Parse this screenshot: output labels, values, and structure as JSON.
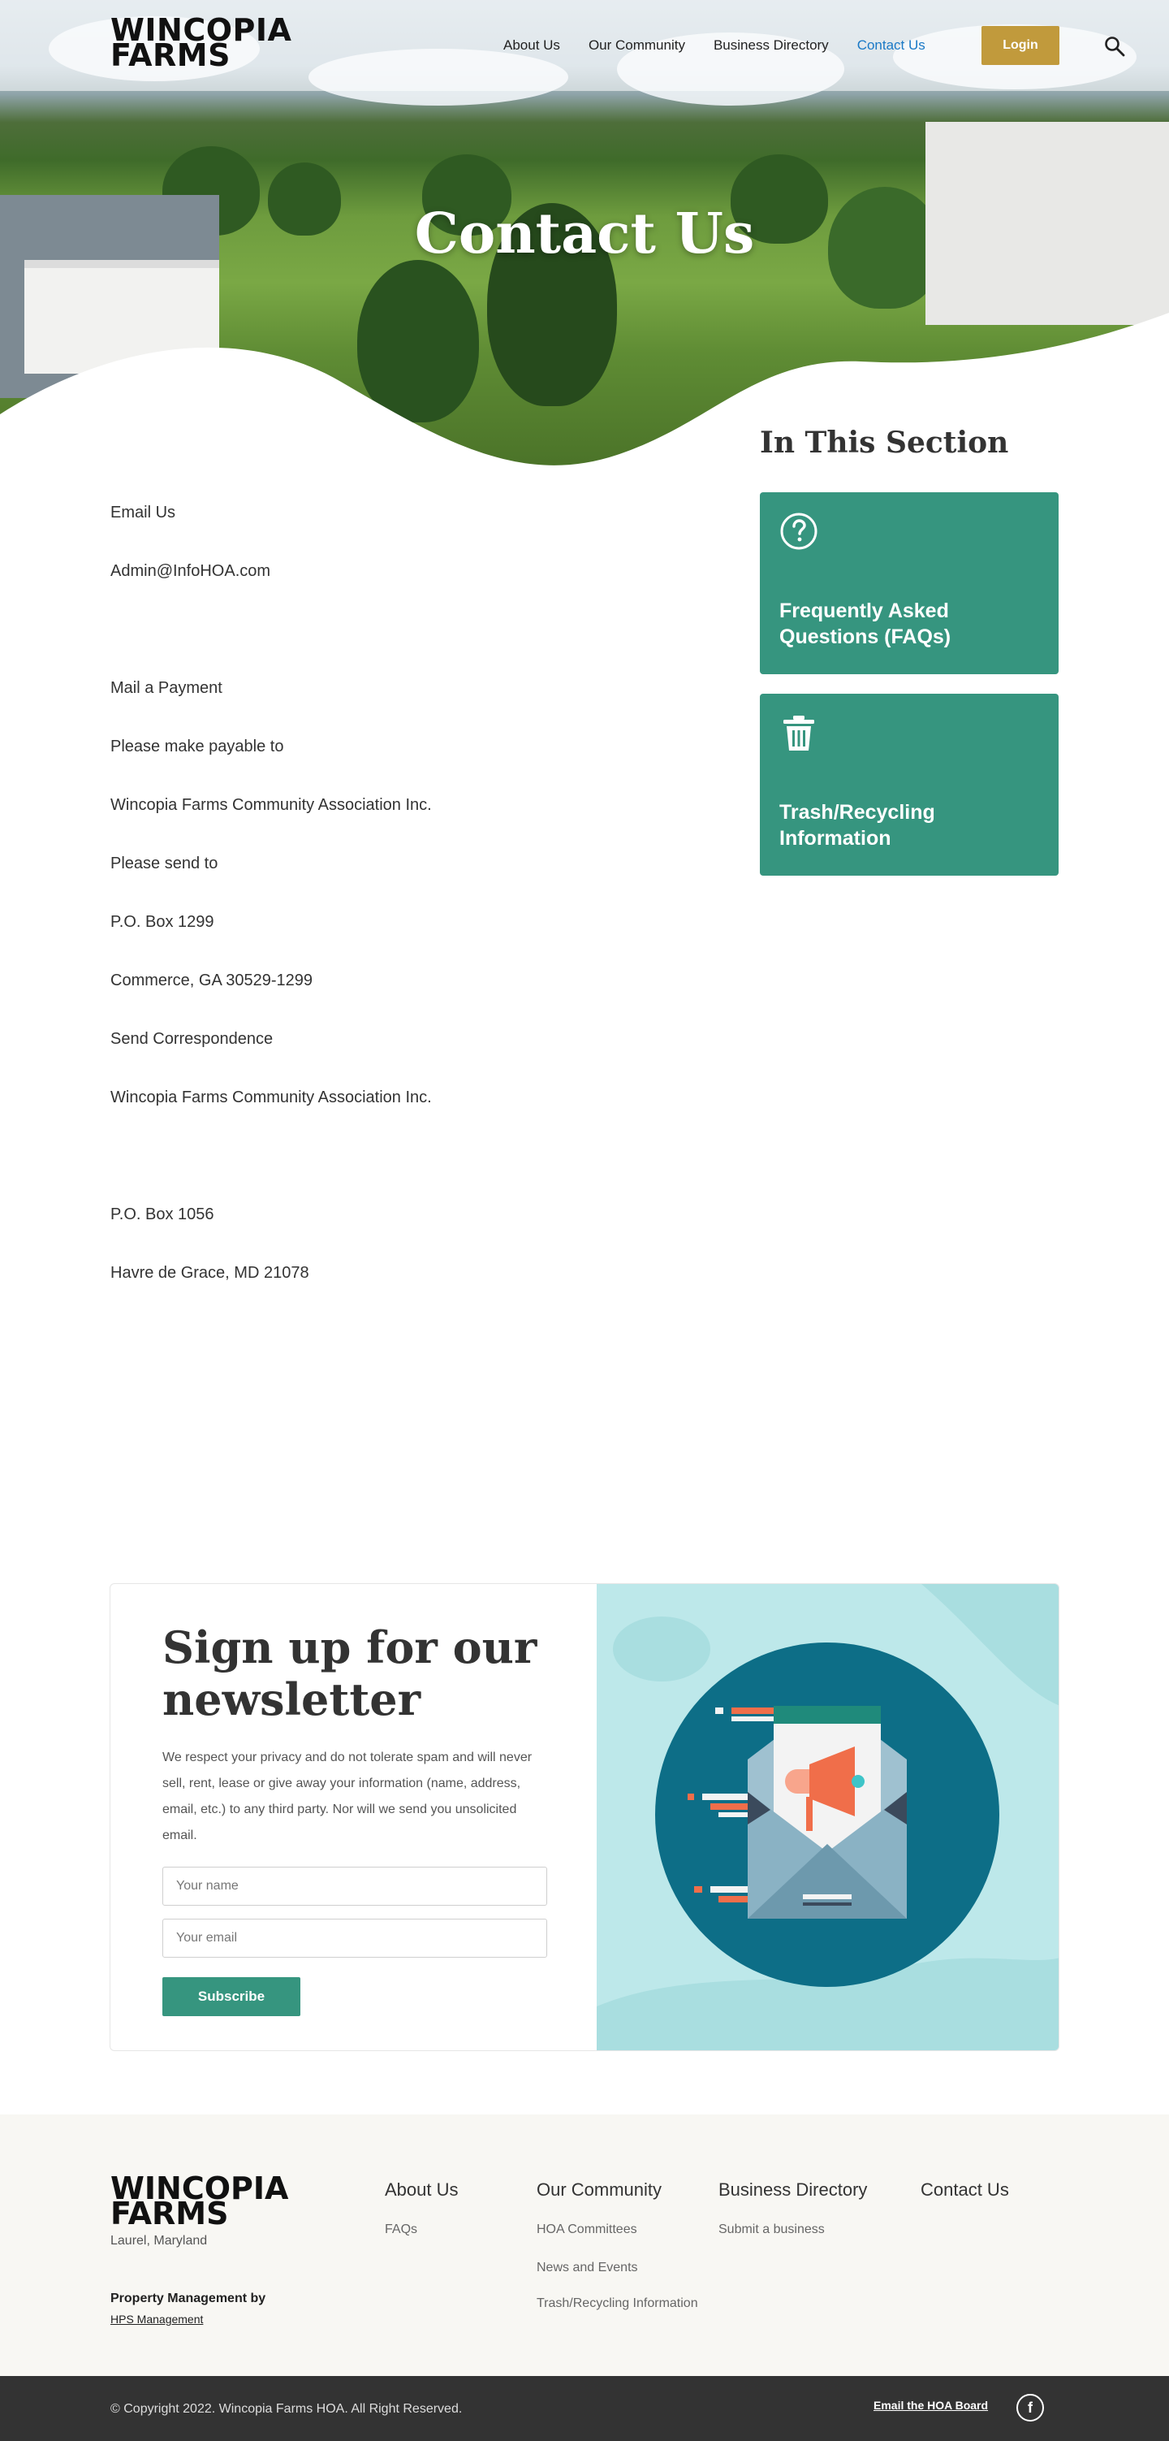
{
  "brand": {
    "logo_line1": "WINCOPIA",
    "logo_line2": "FARMS"
  },
  "nav": {
    "items": [
      {
        "label": "About Us"
      },
      {
        "label": "Our Community"
      },
      {
        "label": "Business Directory"
      },
      {
        "label": "Contact Us",
        "active": true
      }
    ],
    "login_label": "Login",
    "search_icon": "search-icon"
  },
  "hero": {
    "title": "Contact Us"
  },
  "sidebar": {
    "heading": "In This Section",
    "cards": [
      {
        "label": "Frequently Asked Questions (FAQs)",
        "icon": "question-circle-icon"
      },
      {
        "label": "Trash/Recycling Information",
        "icon": "trash-icon"
      }
    ]
  },
  "contact": {
    "lines": [
      "Email Us",
      "Admin@InfoHOA.com",
      "Mail a Payment",
      "Please make payable to",
      "Wincopia Farms Community Association Inc.",
      "Please send to",
      "P.O. Box 1299",
      "Commerce, GA 30529-1299",
      "Send Correspondence",
      "Wincopia Farms Community Association Inc.",
      "P.O. Box 1056",
      "Havre de Grace, MD 21078"
    ]
  },
  "newsletter": {
    "title": "Sign up for our newsletter",
    "text": "We respect your privacy and do not tolerate spam and will never sell, rent, lease or give away your information (name, address, email, etc.) to any third party. Nor will we send you unsolicited email.",
    "name_placeholder": "Your name",
    "email_placeholder": "Your email",
    "button_label": "Subscribe"
  },
  "footer": {
    "logo_line1": "WINCOPIA",
    "logo_line2": "FARMS",
    "location": "Laurel, Maryland",
    "pm_label": "Property Management by",
    "pm_link": "HPS Management",
    "columns": [
      {
        "heading": "About Us",
        "links": [
          "FAQs"
        ]
      },
      {
        "heading": "Our Community",
        "links": [
          "HOA Committees",
          "News and Events",
          "Trash/Recycling Information"
        ]
      },
      {
        "heading": "Business Directory",
        "links": [
          "Submit a business"
        ]
      },
      {
        "heading": "Contact Us",
        "links": []
      }
    ],
    "copyright": "© Copyright 2022. Wincopia Farms HOA. All Right Reserved.",
    "email_board": "Email the HOA Board",
    "social_icon": "facebook-icon"
  },
  "colors": {
    "accent_green": "#36957f",
    "login_gold": "#c19a3c",
    "active_link": "#1a79c6",
    "footer_bar": "#333333"
  }
}
